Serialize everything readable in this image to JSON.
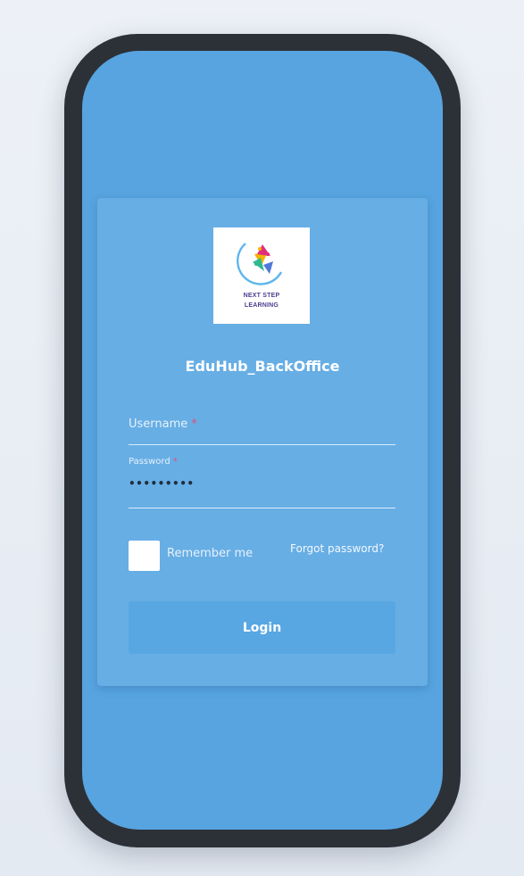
{
  "brand": {
    "logo_icon": "next-step-learning-logo-icon",
    "logo_line1": "NEXT STEP",
    "logo_line2": "LEARNING"
  },
  "app": {
    "title": "EduHub_BackOffice"
  },
  "form": {
    "username": {
      "label": "Username",
      "required_mark": "*",
      "value": ""
    },
    "password": {
      "label": "Password",
      "required_mark": "*",
      "value": "•••••••••"
    },
    "remember_me": {
      "label": "Remember me",
      "checked": false
    },
    "forgot_password_label": "Forgot password?",
    "login_label": "Login"
  },
  "colors": {
    "screen_background": "#57a4e0",
    "card_background": "#67aee5",
    "button_background": "#58a7e3",
    "frame": "#2c3138",
    "required": "#e0507a"
  }
}
